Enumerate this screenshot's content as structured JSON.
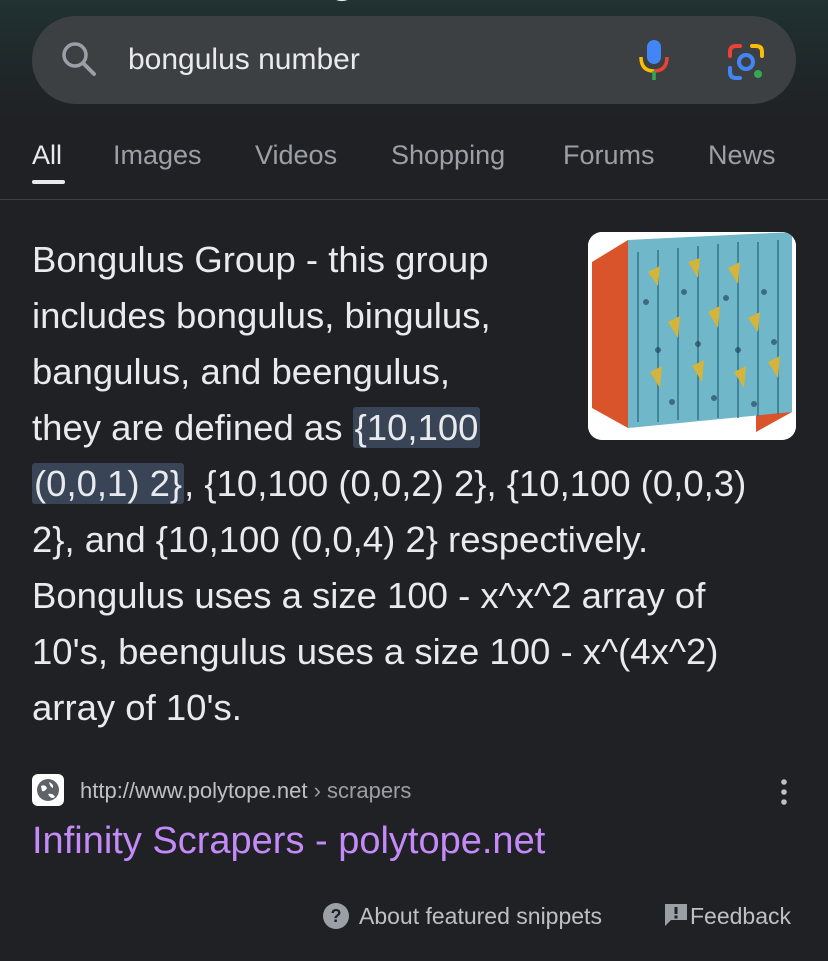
{
  "search": {
    "query": "bongulus number",
    "icons": [
      "search-icon",
      "microphone-icon",
      "google-lens-icon"
    ]
  },
  "tabs": [
    {
      "label": "All",
      "active": true
    },
    {
      "label": "Images",
      "active": false
    },
    {
      "label": "Videos",
      "active": false
    },
    {
      "label": "Shopping",
      "active": false
    },
    {
      "label": "Forums",
      "active": false
    },
    {
      "label": "News",
      "active": false
    }
  ],
  "snippet": {
    "lines": [
      "Bongulus Group - this group",
      "includes bongulus, bingulus,",
      "bangulus, and beengulus,"
    ],
    "line4_prefix": "they are defined as ",
    "highlight_part1": "{10,100",
    "highlight_part2": "(0,0,1) 2}",
    "line5_rest": ", {10,100 (0,0,2) 2}, {10,100 (0,0,3)",
    "line6": "2}, and {10,100 (0,0,4) 2} respectively.",
    "line7": "Bongulus uses a size 100 - x^x^2 array of",
    "line8": "10's, beengulus uses a size 100 - x^(4x^2)",
    "line9": "array of 10's.",
    "image_icon": "tetration-structure-thumbnail"
  },
  "source": {
    "url": "http://www.polytope.net",
    "breadcrumb": " › scrapers",
    "title": "Infinity Scrapers - polytope.net"
  },
  "footer": {
    "about": "About featured snippets",
    "feedback": "Feedback"
  },
  "colors": {
    "background": "#202124",
    "search_bar": "#3c4043",
    "highlight": "#394457",
    "visited_link": "#c58af9"
  }
}
